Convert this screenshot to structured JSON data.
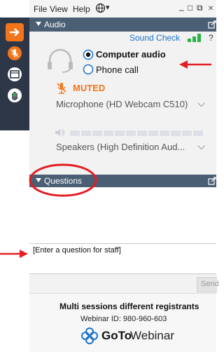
{
  "menubar": {
    "file": "File",
    "view": "View",
    "help": "Help",
    "globe_caret": "▾",
    "minimize": "_",
    "restore": "□",
    "popout": "⧉",
    "close": "×"
  },
  "audio": {
    "title": "Audio",
    "sound_check": "Sound Check",
    "help": "?",
    "options": [
      "Computer audio",
      "Phone call"
    ],
    "selected": "Computer audio",
    "status": "MUTED",
    "microphone": "Microphone (HD Webcam C510)",
    "speakers": "Speakers (High Definition Aud..."
  },
  "questions": {
    "title": "Questions",
    "input_placeholder": "[Enter a question for staff]",
    "send": "Send"
  },
  "footer": {
    "session_title": "Multi sessions different registrants",
    "webinar_id": "Webinar ID: 980-960-603",
    "brand_goto": "GoTo",
    "brand_webinar": "Webinar"
  },
  "colors": {
    "toolbar": "#2d3747",
    "header": "#4a5e74",
    "accent_orange": "#f3751b",
    "sound_green": "#2db24a",
    "annotation_red": "#e31e24",
    "link_blue": "#1a73c9"
  }
}
